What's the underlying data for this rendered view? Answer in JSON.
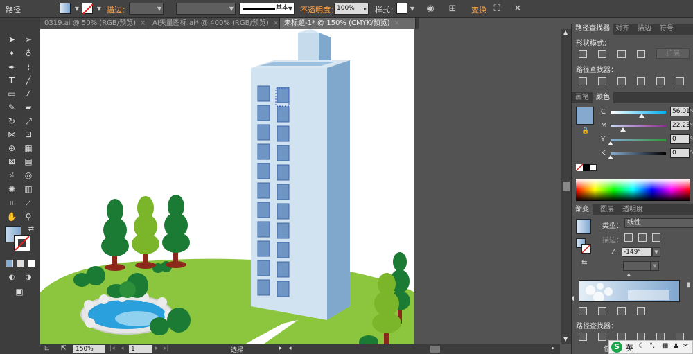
{
  "control_bar": {
    "label_path": "路径",
    "label_stroke": "描边：",
    "stroke_style": "基本",
    "label_opacity": "不透明度：",
    "opacity_value": "100%",
    "label_style": "样式：",
    "transform_link": "变换"
  },
  "tabs": [
    {
      "label": "0319.ai @ 50% (RGB/预览)",
      "close": "×"
    },
    {
      "label": "AI矢量图标.ai* @ 400% (RGB/预览)",
      "close": "×"
    },
    {
      "label": "未标题-1* @ 150% (CMYK/预览)",
      "close": "×"
    }
  ],
  "status_bar": {
    "zoom": "150%",
    "page": "1",
    "tool_label": "选择"
  },
  "pathfinder_panel": {
    "tabs": [
      "路径查找器",
      "对齐",
      "描边",
      "符号"
    ],
    "shape_modes": "形状模式：",
    "expand": "扩展",
    "pathfinders": "路径查找器："
  },
  "color_panel": {
    "tabs": [
      "画笔",
      "颜色"
    ],
    "channels": [
      {
        "label": "C",
        "value": "56.01",
        "unit": "%",
        "level": 0.56
      },
      {
        "label": "M",
        "value": "22.23",
        "unit": "%",
        "level": 0.22
      },
      {
        "label": "Y",
        "value": "0",
        "unit": "%",
        "level": 0
      },
      {
        "label": "K",
        "value": "0",
        "unit": "%",
        "level": 0
      }
    ],
    "fill_color": "#86a9cf"
  },
  "gradient_panel": {
    "tabs": [
      "渐变",
      "图层",
      "透明度"
    ],
    "type_label": "类型：",
    "type_value": "线性",
    "stroke_label": "描边：",
    "angle_value": "-149°"
  },
  "bottom_panel": {
    "pathfinders": "路径查找器：",
    "position_label": "位"
  },
  "ime": {
    "logo": "S",
    "lang": "英"
  }
}
